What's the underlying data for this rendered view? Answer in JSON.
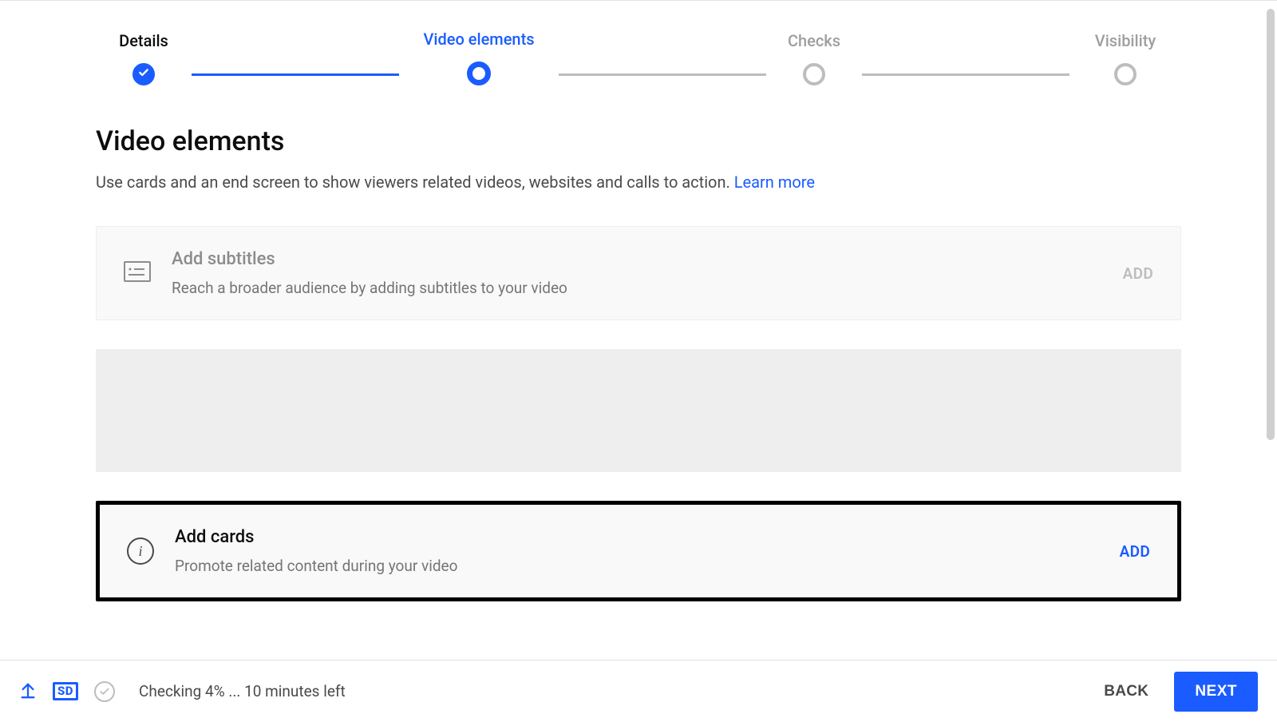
{
  "stepper": {
    "steps": [
      {
        "label": "Details"
      },
      {
        "label": "Video elements"
      },
      {
        "label": "Checks"
      },
      {
        "label": "Visibility"
      }
    ]
  },
  "page": {
    "title": "Video elements",
    "subtitle_lead": "Use cards and an end screen to show viewers related videos, websites and calls to action. ",
    "learn_more": "Learn more"
  },
  "options": {
    "subtitles": {
      "title": "Add subtitles",
      "desc": "Reach a broader audience by adding subtitles to your video",
      "action": "ADD"
    },
    "cards": {
      "title": "Add cards",
      "desc": "Promote related content during your video",
      "action": "ADD"
    }
  },
  "footer": {
    "sd_label": "SD",
    "status": "Checking 4% ... 10 minutes left",
    "back": "BACK",
    "next": "NEXT"
  }
}
